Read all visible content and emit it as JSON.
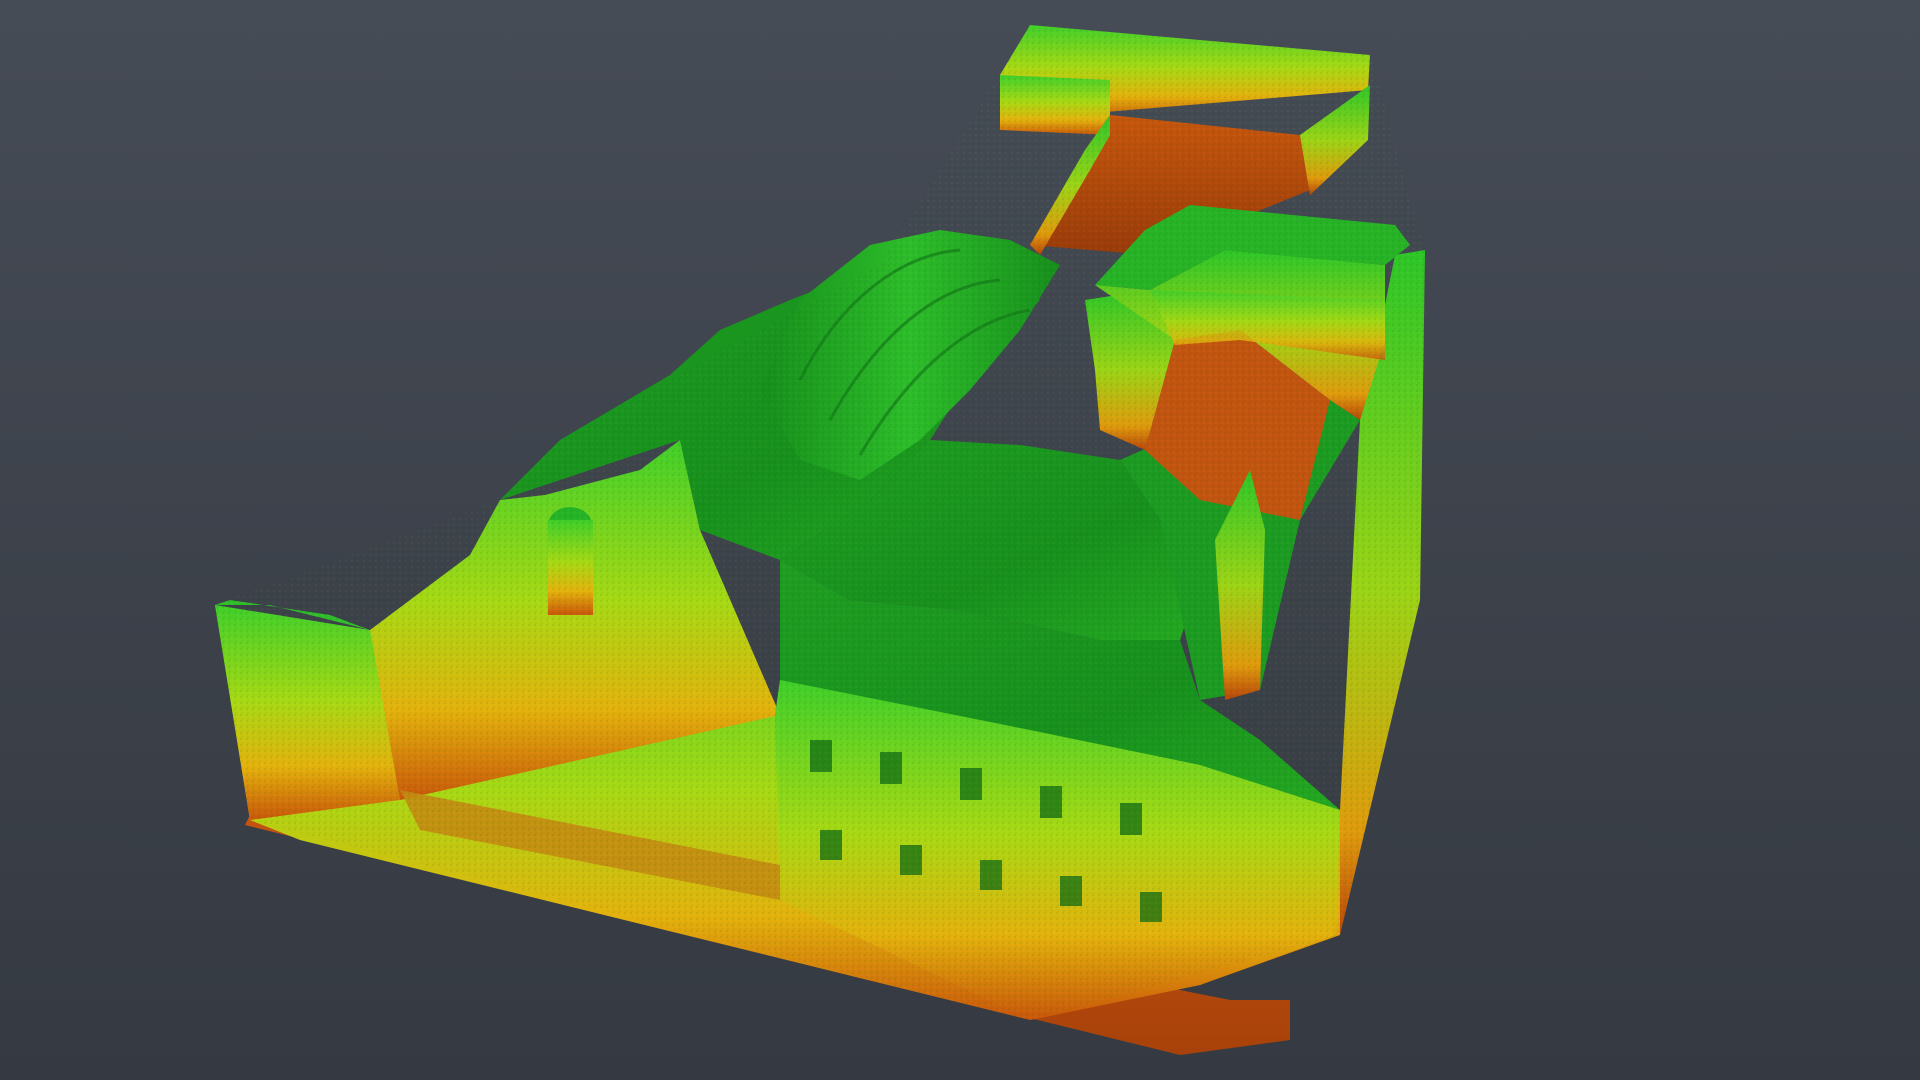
{
  "viewer": {
    "background_top": "#464c56",
    "background_bottom": "#353a42"
  },
  "point_cloud": {
    "colormap": "elevation",
    "color_low": "#b8440a",
    "color_mid": "#e8b40c",
    "color_high": "#16a51b"
  }
}
